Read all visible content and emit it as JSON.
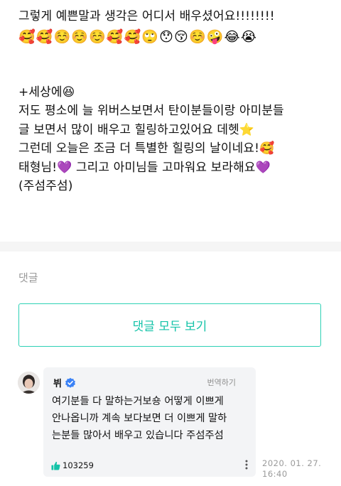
{
  "post": {
    "line1": "그렇게 예쁜말과 생각은 어디서 배우셨어요!!!!!!!!",
    "emoji_row": [
      "🥰",
      "🥰",
      "☺️",
      "☺️",
      "☺️",
      "🥰",
      "🥰",
      "🙄",
      "😯",
      "😚",
      "☺️",
      "🤪",
      "😂",
      "😭"
    ],
    "line2": "+세상에",
    "line2_emoji": "😆",
    "line3": "저도 평소에 늘 위버스보면서 탄이분들이랑 아미분들",
    "line4": "글 보면서 많이 배우고 힐링하고있어요 데헷",
    "line4_emoji": "⭐",
    "line5": "그런데 오늘은 조금 더 특별한 힐링의 날이네요!",
    "line5_emoji": "🥰",
    "line6a": "태형님!",
    "line6a_emoji": "💜",
    "line6b": "그리고 아미님들 고마워요 보라해요",
    "line6b_emoji": "💜",
    "line7": "(주섬주섬)"
  },
  "comments": {
    "heading": "댓글",
    "view_all_label": "댓글 모두 보기"
  },
  "reply": {
    "author": "뷔",
    "translate_label": "번역하기",
    "text_lines": [
      "여기분들 다 말하는거보숑 어떻게 이쁘게",
      "안나옵니까 계속 보다보면 더 이쁘게 말하",
      "는분들 많아서 배우고 있습니다 주섬주섬"
    ],
    "like_count": "103259",
    "date": "2020. 01. 27.",
    "time": "16:40"
  },
  "colors": {
    "accent": "#14c3a8",
    "verified": "#3b82f6"
  }
}
